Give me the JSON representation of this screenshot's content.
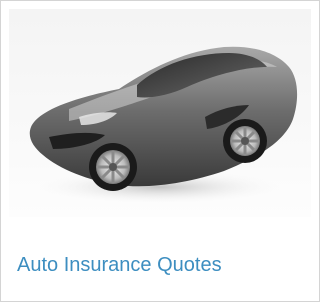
{
  "card": {
    "image_subject": "silver-sports-car",
    "link_label": "Auto Insurance Quotes",
    "link_color": "#3d8ec0",
    "border_color": "#d4d4d4"
  }
}
